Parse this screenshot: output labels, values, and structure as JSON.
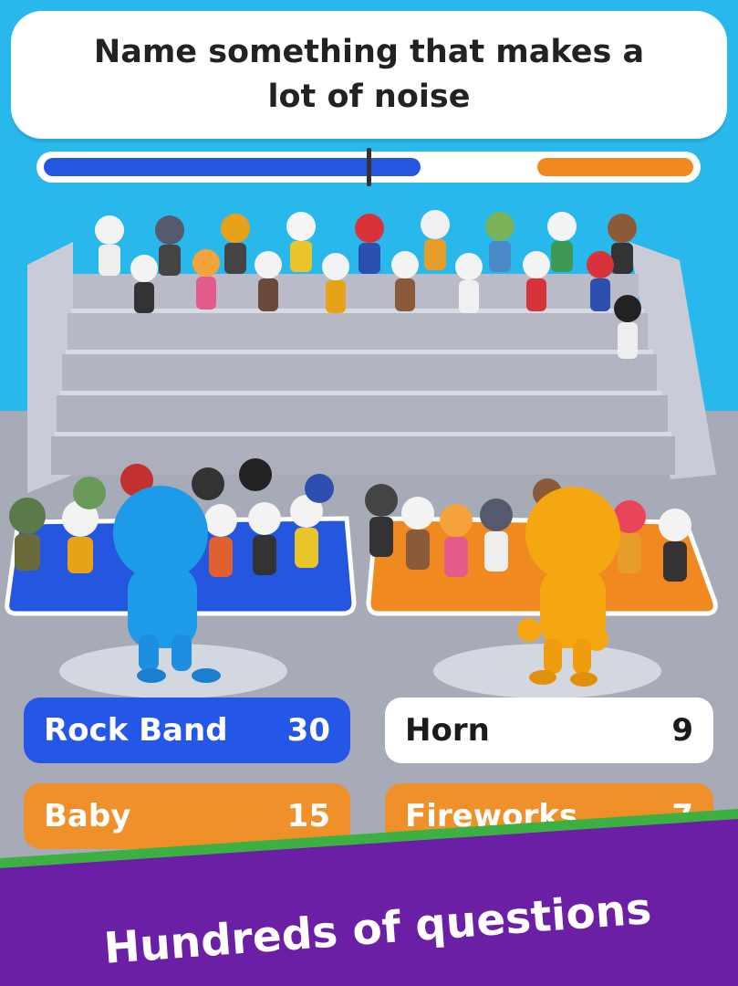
{
  "question": {
    "text": "Name something that makes a lot of noise"
  },
  "vote_bar": {
    "blue_share": 0.58,
    "orange_share": 0.24
  },
  "teams": {
    "blue": {
      "color": "#2456e0",
      "player_color": "#1e9be8"
    },
    "orange": {
      "color": "#f08a20",
      "player_color": "#f5a712"
    }
  },
  "answers": [
    {
      "label": "Rock Band",
      "points": "30",
      "style": "blue"
    },
    {
      "label": "Horn",
      "points": "9",
      "style": "white"
    },
    {
      "label": "Baby",
      "points": "15",
      "style": "orange"
    },
    {
      "label": "Fireworks",
      "points": "7",
      "style": "orange"
    }
  ],
  "banner": {
    "text": "Hundreds of questions",
    "color": "#6a1fa5",
    "stripe_color": "#3cb043"
  }
}
